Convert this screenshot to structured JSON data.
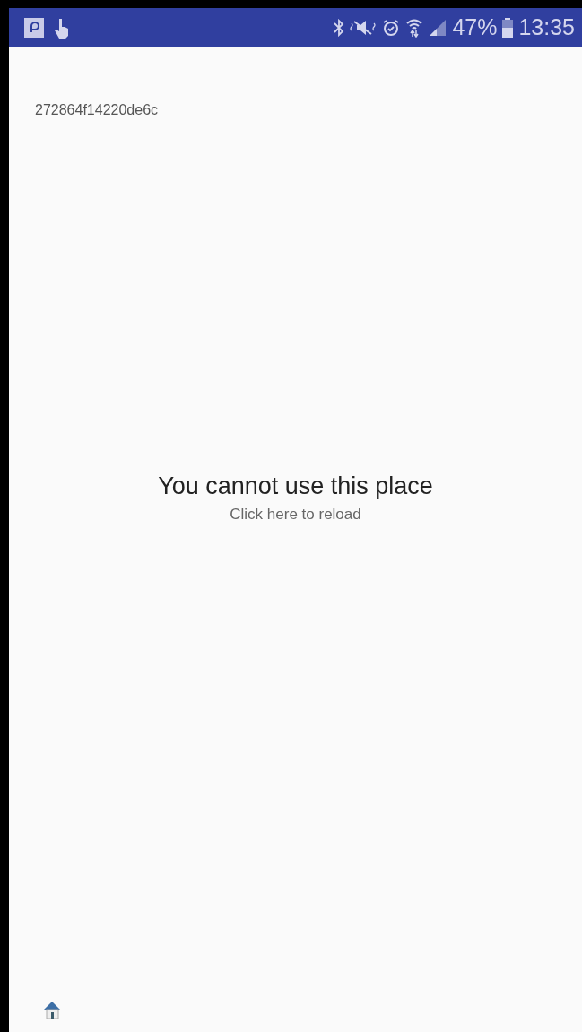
{
  "status_bar": {
    "battery": "47%",
    "time": "13:35"
  },
  "device_id": "272864f14220de6c",
  "message": {
    "title": "You cannot use this place",
    "reload_link": "Click here to reload"
  }
}
